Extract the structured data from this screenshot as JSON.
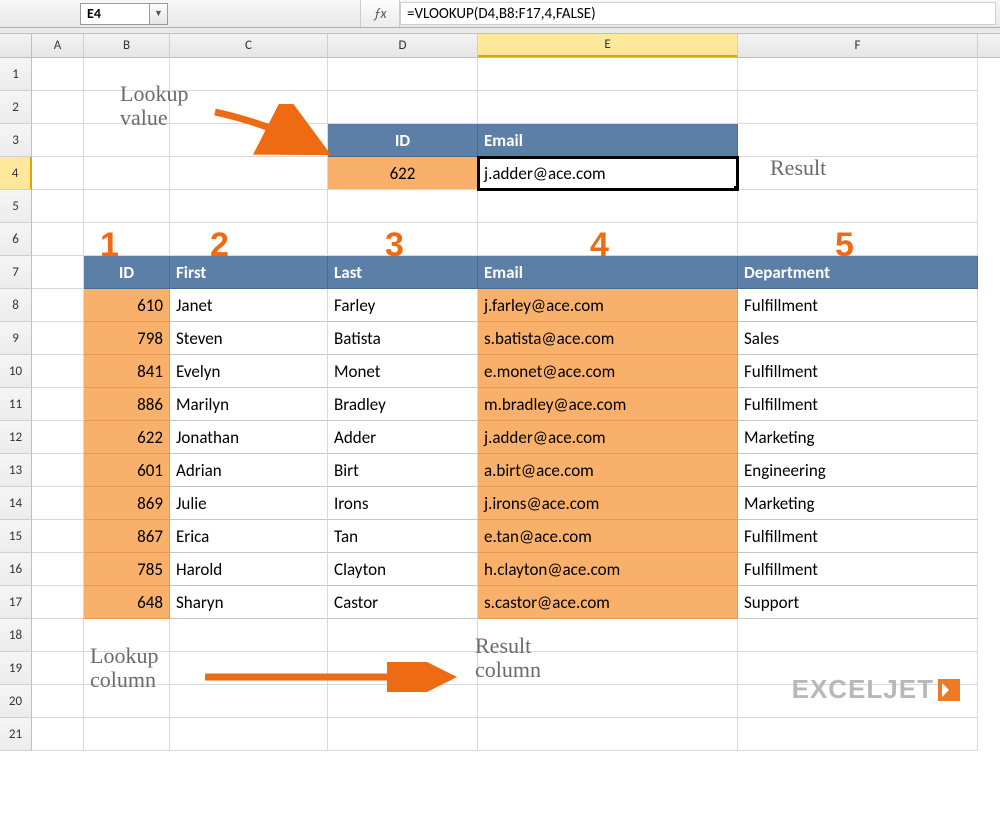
{
  "namebox": "E4",
  "formula": "=VLOOKUP(D4,B8:F17,4,FALSE)",
  "columns": [
    "A",
    "B",
    "C",
    "D",
    "E",
    "F"
  ],
  "active_column_index": 4,
  "row_numbers": [
    1,
    2,
    3,
    4,
    5,
    6,
    7,
    8,
    9,
    10,
    11,
    12,
    13,
    14,
    15,
    16,
    17,
    18,
    19,
    20,
    21
  ],
  "active_row": 4,
  "lookup_header": {
    "id": "ID",
    "email": "Email"
  },
  "lookup_row": {
    "id": "622",
    "email": "j.adder@ace.com"
  },
  "table_header": {
    "id": "ID",
    "first": "First",
    "last": "Last",
    "email": "Email",
    "dept": "Department"
  },
  "table": [
    {
      "id": "610",
      "first": "Janet",
      "last": "Farley",
      "email": "j.farley@ace.com",
      "dept": "Fulfillment"
    },
    {
      "id": "798",
      "first": "Steven",
      "last": "Batista",
      "email": "s.batista@ace.com",
      "dept": "Sales"
    },
    {
      "id": "841",
      "first": "Evelyn",
      "last": "Monet",
      "email": "e.monet@ace.com",
      "dept": "Fulfillment"
    },
    {
      "id": "886",
      "first": "Marilyn",
      "last": "Bradley",
      "email": "m.bradley@ace.com",
      "dept": "Fulfillment"
    },
    {
      "id": "622",
      "first": "Jonathan",
      "last": "Adder",
      "email": "j.adder@ace.com",
      "dept": "Marketing"
    },
    {
      "id": "601",
      "first": "Adrian",
      "last": "Birt",
      "email": "a.birt@ace.com",
      "dept": "Engineering"
    },
    {
      "id": "869",
      "first": "Julie",
      "last": "Irons",
      "email": "j.irons@ace.com",
      "dept": "Marketing"
    },
    {
      "id": "867",
      "first": "Erica",
      "last": "Tan",
      "email": "e.tan@ace.com",
      "dept": "Fulfillment"
    },
    {
      "id": "785",
      "first": "Harold",
      "last": "Clayton",
      "email": "h.clayton@ace.com",
      "dept": "Fulfillment"
    },
    {
      "id": "648",
      "first": "Sharyn",
      "last": "Castor",
      "email": "s.castor@ace.com",
      "dept": "Support"
    }
  ],
  "annotations": {
    "lookup_value": "Lookup\nvalue",
    "result": "Result",
    "lookup_column": "Lookup\ncolumn",
    "result_column": "Result\ncolumn",
    "col_nums": [
      "1",
      "2",
      "3",
      "4",
      "5"
    ]
  },
  "logo": "EXCELJET"
}
